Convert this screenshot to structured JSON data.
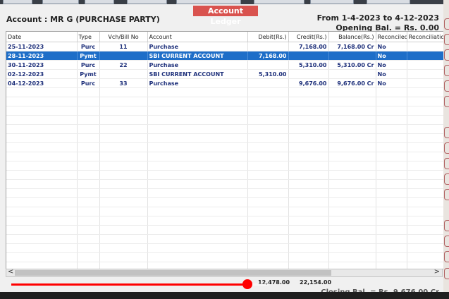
{
  "window": {
    "title": "Account Ledger",
    "account": "Account : MR G (PURCHASE PARTY)",
    "period": "From 1-4-2023 to 4-12-2023",
    "opening_balance": "Opening Bal. = Rs. 0.00",
    "closing_balance": "Closing Bal. =  Rs. 9,676.00 Cr"
  },
  "table": {
    "columns": [
      "Date",
      "Type",
      "Vch/Bill No",
      "Account",
      "Debit(Rs.)",
      "Credit(Rs.)",
      "Balance(Rs.)",
      "Reconciled",
      "Reconciliation"
    ],
    "rows": [
      {
        "date": "25-11-2023",
        "type": "Purc",
        "vch": "11",
        "account": "Purchase",
        "debit": "",
        "credit": "7,168.00",
        "balance": "7,168.00 Cr",
        "reconciled": "No",
        "reconciliation": ""
      },
      {
        "date": "28-11-2023",
        "type": "Pymt",
        "vch": "",
        "account": "SBI CURRENT ACCOUNT",
        "debit": "7,168.00",
        "credit": "",
        "balance": "",
        "reconciled": "No",
        "reconciliation": ""
      },
      {
        "date": "30-11-2023",
        "type": "Purc",
        "vch": "22",
        "account": "Purchase",
        "debit": "",
        "credit": "5,310.00",
        "balance": "5,310.00 Cr",
        "reconciled": "No",
        "reconciliation": ""
      },
      {
        "date": "02-12-2023",
        "type": "Pymt",
        "vch": "",
        "account": "SBI CURRENT ACCOUNT",
        "debit": "5,310.00",
        "credit": "",
        "balance": "",
        "reconciled": "No",
        "reconciliation": ""
      },
      {
        "date": "04-12-2023",
        "type": "Purc",
        "vch": "33",
        "account": "Purchase",
        "debit": "",
        "credit": "9,676.00",
        "balance": "9,676.00 Cr",
        "reconciled": "No",
        "reconciliation": ""
      }
    ],
    "selected_row": 1,
    "totals": {
      "debit": "12,478.00",
      "credit": "22,154.00"
    }
  },
  "scrollbar": {
    "left_icon": "chevron-left-icon",
    "right_icon": "chevron-right-icon",
    "left_glyph": "<",
    "right_glyph": ">"
  },
  "video_player": {
    "progress_fraction": 0.92,
    "accent_color": "#ff0000"
  },
  "colors": {
    "selection": "#1e6ec8",
    "title_badge": "#d9534f",
    "row_text": "#1d2f7a"
  }
}
